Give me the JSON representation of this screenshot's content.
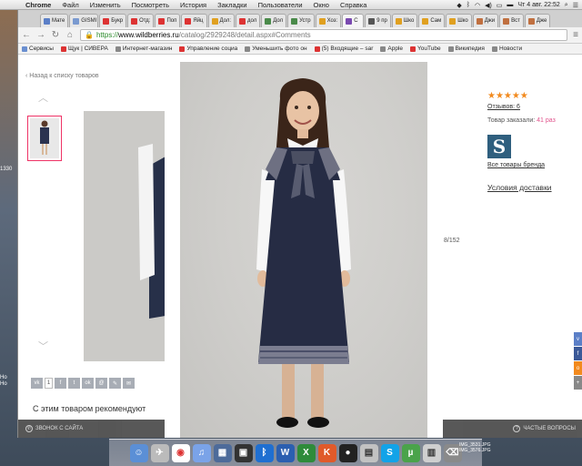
{
  "menubar": {
    "app": "Chrome",
    "items": [
      "Файл",
      "Изменить",
      "Посмотреть",
      "История",
      "Закладки",
      "Пользователи",
      "Окно",
      "Справка"
    ],
    "clock": "Чт 4 авг.  22:52"
  },
  "tabs": [
    {
      "label": "Мате",
      "color": "#5b7fc7"
    },
    {
      "label": "GISMI",
      "color": "#7a9ad0"
    },
    {
      "label": "Букр",
      "color": "#d33"
    },
    {
      "label": "Отд:",
      "color": "#d33"
    },
    {
      "label": "Поп",
      "color": "#d33"
    },
    {
      "label": "Яйц",
      "color": "#d33"
    },
    {
      "label": "Дол:",
      "color": "#e0a020"
    },
    {
      "label": "дол",
      "color": "#d33"
    },
    {
      "label": "Дол",
      "color": "#4a8a4a"
    },
    {
      "label": "Устр",
      "color": "#4a8a4a"
    },
    {
      "label": "Хоз:",
      "color": "#e0a020"
    },
    {
      "label": "С",
      "color": "#7a4ab0"
    },
    {
      "label": "9 пр",
      "color": "#555"
    },
    {
      "label": "Шко",
      "color": "#e0a020"
    },
    {
      "label": "Сам",
      "color": "#e0a020"
    },
    {
      "label": "Шко",
      "color": "#e0a020"
    },
    {
      "label": "Джи",
      "color": "#c07040"
    },
    {
      "label": "Вст",
      "color": "#c07040"
    },
    {
      "label": "Дже",
      "color": "#c07040"
    }
  ],
  "toolbar": {
    "url_scheme": "https://",
    "url_host": "www.wildberries.ru",
    "url_path": "/catalog/2929248/detail.aspx#Comments"
  },
  "bookmarks": [
    {
      "label": "Сервисы",
      "color": "#6a8fd0"
    },
    {
      "label": "Щук | СИВЕРА",
      "color": "#d33"
    },
    {
      "label": "Интернет-магазин",
      "color": "#888"
    },
    {
      "label": "Управление социа",
      "color": "#d33"
    },
    {
      "label": "Уменьшить фото он",
      "color": "#888"
    },
    {
      "label": "(5) Входящие – sar",
      "color": "#d33"
    },
    {
      "label": "Apple",
      "color": "#888"
    },
    {
      "label": "YouTube",
      "color": "#d33"
    },
    {
      "label": "Википедия",
      "color": "#888"
    },
    {
      "label": "Новости",
      "color": "#888"
    }
  ],
  "page": {
    "back_link": "Назад к списку товаров",
    "rating_stars": "★★★★★",
    "reviews": "Отзывов: 6",
    "ordered_label": "Товар заказали: ",
    "ordered_count": "41 раз",
    "brand_letter": "S",
    "brand_link": "Все товары бренда",
    "delivery": "Условия доставки",
    "counter": "8/152",
    "recommend_title": "С этим товаром рекомендуют",
    "social_count": "1",
    "call_text": "ЗВОНОК С САЙТА",
    "faq_text": "ЧАСТЫЕ ВОПРОСЫ"
  },
  "desktop": {
    "left_label": "1330",
    "dock_files": [
      "IMG_3531.JPG",
      "IMG_3576.JPG"
    ]
  }
}
